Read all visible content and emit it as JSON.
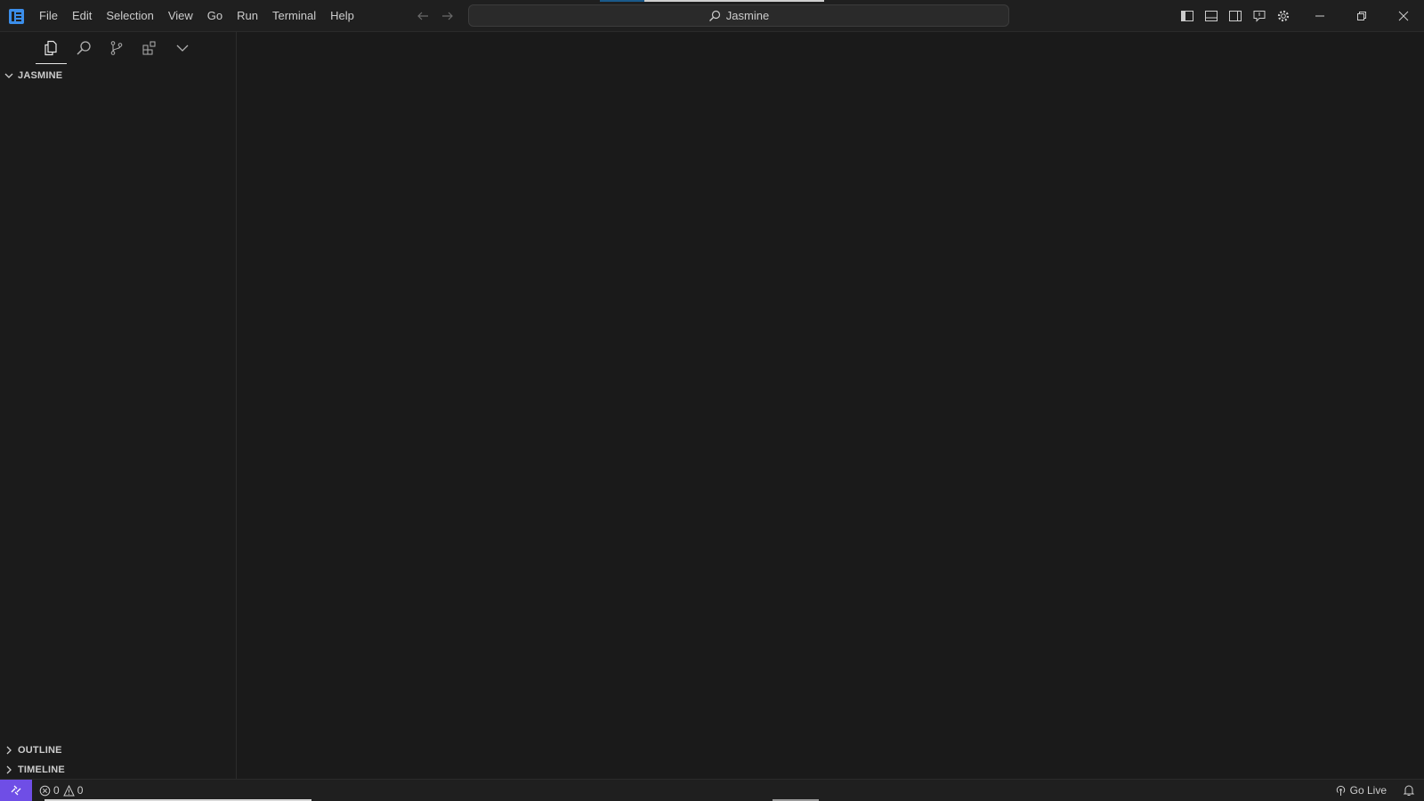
{
  "app": {
    "logo_icon": "vscode-logo-icon",
    "accent": "#3b8eea"
  },
  "menu": [
    "File",
    "Edit",
    "Selection",
    "View",
    "Go",
    "Run",
    "Terminal",
    "Help"
  ],
  "command_center": {
    "label": "Jasmine",
    "icon": "search-icon"
  },
  "layout_controls": [
    "toggle-primary-sidebar-icon",
    "toggle-panel-icon",
    "toggle-secondary-sidebar-icon",
    "toggle-chat-icon",
    "settings-gear-icon"
  ],
  "window_controls": [
    "minimize-icon",
    "restore-icon",
    "close-icon"
  ],
  "sidebar": {
    "tabs": [
      "explorer-icon",
      "search-icon",
      "source-control-icon",
      "extensions-icon",
      "more-chevron-icon"
    ],
    "sections": {
      "folder": "JASMINE",
      "outline": "OUTLINE",
      "timeline": "TIMELINE"
    }
  },
  "statusbar": {
    "remote_color": "#6f4ee6",
    "errors": "0",
    "warnings": "0",
    "go_live": "Go Live"
  }
}
